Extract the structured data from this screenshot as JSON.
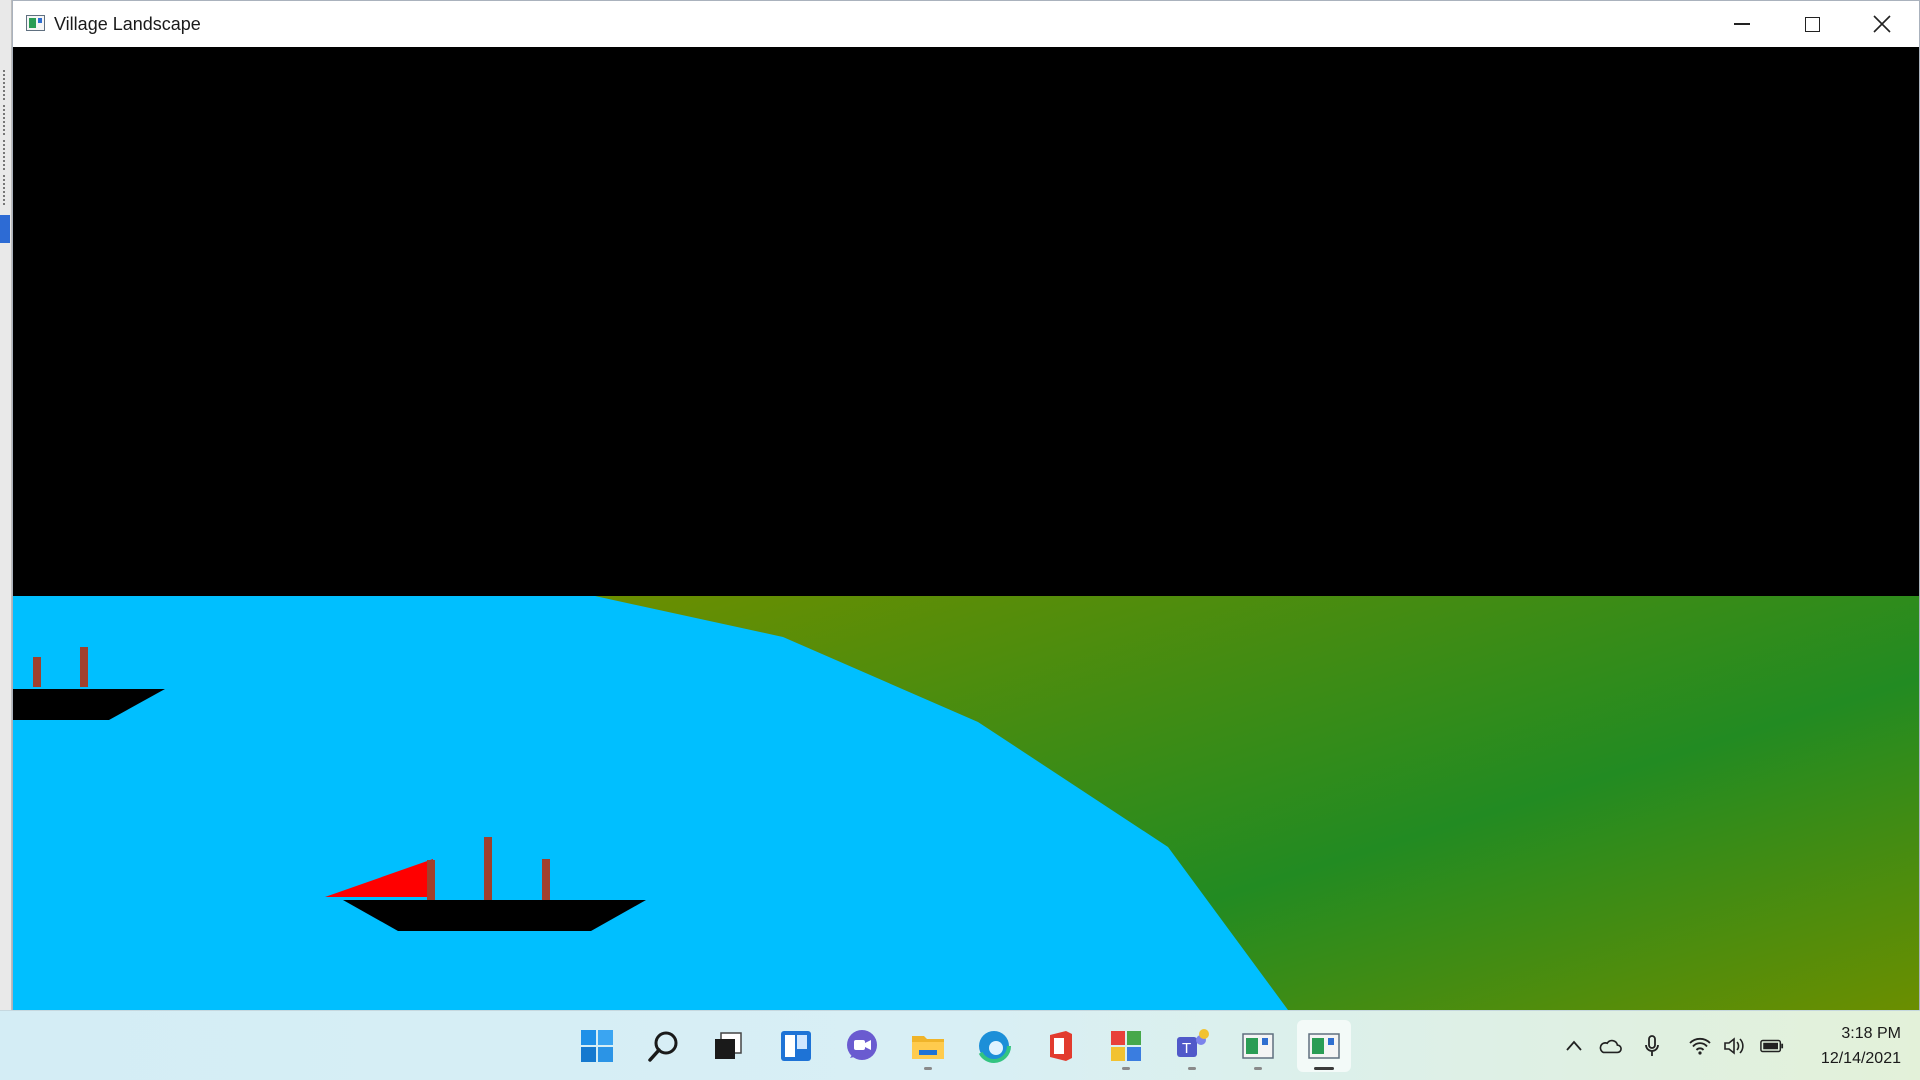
{
  "window": {
    "title": "Village Landscape",
    "controls": {
      "minimize": "minimize-icon",
      "maximize": "maximize-icon",
      "close": "close-icon"
    }
  },
  "scene": {
    "colors": {
      "sky": "#000000",
      "water": "#00bfff",
      "land_light": "#6b8e00",
      "land_dark": "#228b22",
      "hull": "#000000",
      "chimney": "#a0402d",
      "sail": "#ff0000"
    },
    "objects": [
      "sky",
      "river",
      "land",
      "boat-small",
      "boat-large"
    ]
  },
  "taskbar": {
    "apps": [
      {
        "name": "start",
        "icon": "windows-logo-icon"
      },
      {
        "name": "search",
        "icon": "search-icon"
      },
      {
        "name": "task-view",
        "icon": "task-view-icon"
      },
      {
        "name": "widgets",
        "icon": "widgets-icon"
      },
      {
        "name": "chat",
        "icon": "chat-icon"
      },
      {
        "name": "file-explorer",
        "icon": "folder-icon",
        "running": true
      },
      {
        "name": "edge",
        "icon": "edge-icon"
      },
      {
        "name": "office",
        "icon": "office-icon"
      },
      {
        "name": "app-colorful",
        "icon": "colorful-app-icon",
        "running": true
      },
      {
        "name": "teams",
        "icon": "teams-icon",
        "running": true
      },
      {
        "name": "app-window-1",
        "icon": "app-window-icon",
        "running": true
      },
      {
        "name": "app-window-2",
        "icon": "app-window-icon",
        "running": true,
        "active": true
      }
    ],
    "tray": {
      "icons": [
        "chevron-up-icon",
        "cloud-icon",
        "microphone-icon",
        "wifi-icon",
        "speaker-icon",
        "battery-icon"
      ],
      "time": "3:18 PM",
      "date": "12/14/2021"
    }
  }
}
